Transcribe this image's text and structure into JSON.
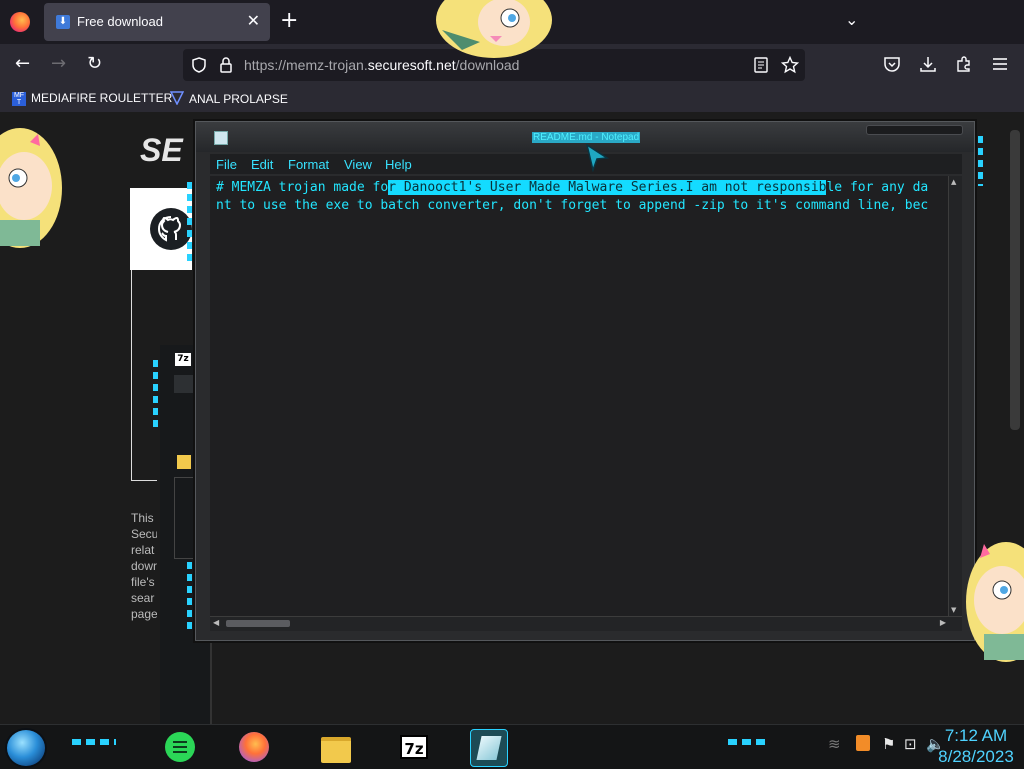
{
  "browser": {
    "tab": {
      "title": "Free download",
      "close": "✕"
    },
    "new_tab": "+",
    "tab_list": "⌄",
    "nav": {
      "back": "←",
      "forward": "→",
      "reload": "↻"
    },
    "url": {
      "prefix": "https://memz-trojan.",
      "domain": "securesoft.net",
      "path": "/download"
    },
    "toolbar_icons": [
      "reader-icon",
      "star-icon",
      "pocket-icon",
      "download-icon",
      "extensions-icon",
      "menu-icon"
    ],
    "bookmarks": [
      {
        "label": "MEDIAFIRE ROULETTER",
        "icon": "mediafire-icon"
      },
      {
        "label": "ANAL PROLAPSE",
        "icon": "bookmark-icon"
      }
    ]
  },
  "page": {
    "brand_partial": "SE",
    "text_lines": [
      "This",
      "Secu",
      "relat",
      "dowr",
      "file's",
      "sear",
      "page"
    ]
  },
  "notepad": {
    "title": "README.md - Notepad",
    "menu": [
      "File",
      "Edit",
      "Format",
      "View",
      "Help"
    ],
    "line1_pre": "# MEMZA trojan made fo",
    "line1_sel": "r Danooct1's User Made Malware Series.I am not responsib",
    "line1_post": "le for any da",
    "line2": "nt to use the exe to batch converter, don't forget to append -zip to it's command line, bec"
  },
  "taskbar": {
    "apps": [
      {
        "name": "notes-app-icon",
        "color": "#2bd657"
      },
      {
        "name": "firefox-icon",
        "color": "#ff7139"
      },
      {
        "name": "file-explorer-icon",
        "color": "#f2c94c"
      },
      {
        "name": "7zip-icon",
        "label": "7z"
      },
      {
        "name": "notepad-icon",
        "color": "#bfe8f2"
      }
    ],
    "clock": {
      "time": "7:12 AM",
      "date": "8/28/2023"
    }
  },
  "accent_colors": {
    "cyan": "#22e6ff",
    "selection": "#14dbff",
    "clock": "#4fd3ff"
  }
}
